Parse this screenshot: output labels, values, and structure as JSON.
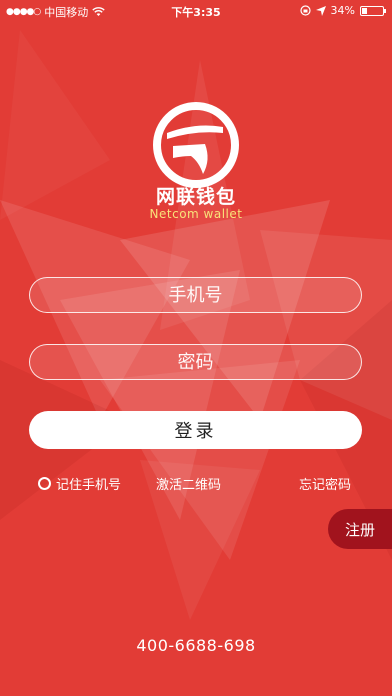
{
  "status_bar": {
    "signal_dots": "●●●●○",
    "carrier": "中国移动",
    "time": "下午3:35",
    "battery": "34%",
    "battery_level": 0.34
  },
  "app": {
    "name": "网联钱包",
    "subtitle": "Netcom wallet"
  },
  "form": {
    "phone_placeholder": "手机号",
    "password_placeholder": "密码",
    "login_label": "登录"
  },
  "links": {
    "remember_label": "记住手机号",
    "activate_label": "激活二维码",
    "forgot_label": "忘记密码"
  },
  "register_label": "注册",
  "hotline": "400-6688-698",
  "colors": {
    "background": "#e23c36",
    "register_bg": "#a1131d",
    "subtitle": "#f8e27a"
  }
}
